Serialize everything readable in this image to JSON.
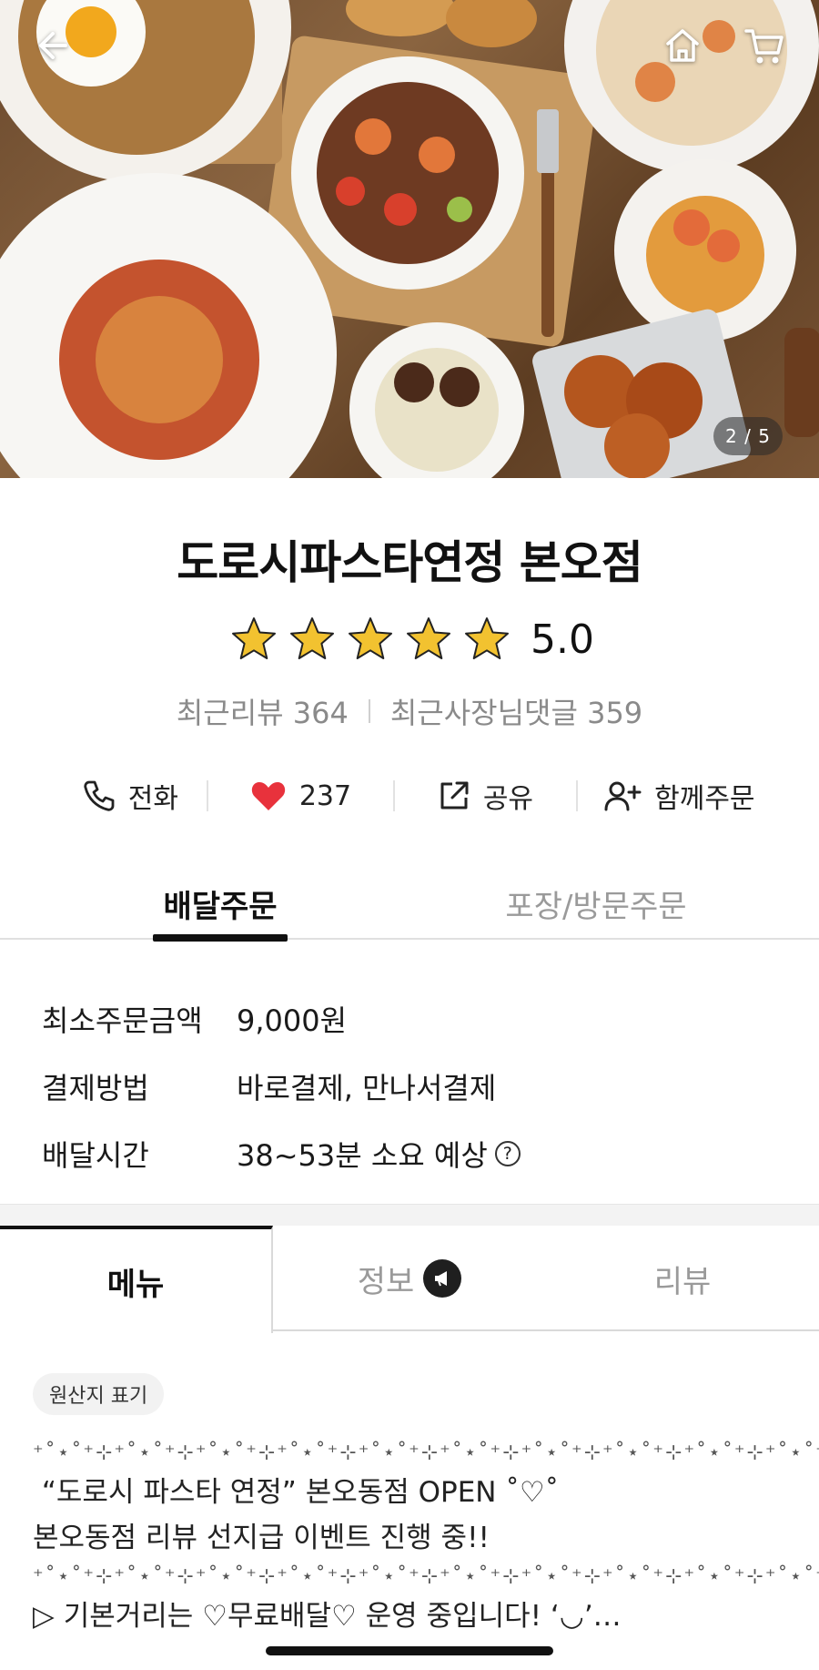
{
  "hero": {
    "image_counter": "2 / 5",
    "icons": [
      "arrow-left-icon",
      "home-icon",
      "cart-icon"
    ]
  },
  "store": {
    "name": "도로시파스타연정 본오점",
    "rating": "5.0",
    "stars_filled": 5,
    "stars_total": 5,
    "recent_reviews": "최근리뷰 364",
    "recent_owner_replies": "최근사장님댓글 359"
  },
  "actions": {
    "call": "전화",
    "likes": "237",
    "share": "공유",
    "group_order": "함께주문"
  },
  "order_tabs": {
    "delivery": "배달주문",
    "pickup": "포장/방문주문",
    "active": "delivery"
  },
  "info": {
    "min_order_label": "최소주문금액",
    "min_order_value": "9,000원",
    "payment_label": "결제방법",
    "payment_value": "바로결제, 만나서결제",
    "delivery_time_label": "배달시간",
    "delivery_time_value": "38~53분 소요 예상"
  },
  "menu_tabs": {
    "menu": "메뉴",
    "info": "정보",
    "review": "리뷰",
    "active": "menu"
  },
  "notice": {
    "origin_label": "원산지 표기",
    "deco_line": "⁺˚⋆˚⁺⊹⁺˚⋆˚⁺⊹⁺˚⋆˚⁺⊹⁺˚⋆˚⁺⊹⁺˚⋆˚⁺⊹⁺˚⋆˚⁺⊹⁺˚⋆˚⁺⊹⁺˚⋆˚⁺⊹⁺˚⋆˚⁺⊹⁺˚⋆˚⁺⊹",
    "line1": " “도로시 파스타 연정” 본오동점 OPEN ˚♡˚",
    "line2": "본오동점 리뷰 선지급 이벤트 진행 중!!",
    "line3": "▷ 기본거리는 ♡무료배달♡ 운영 중입니다! ‘◡’…"
  },
  "colors": {
    "star": "#F2C230",
    "heart": "#E8323C",
    "text_primary": "#111111",
    "text_muted": "#8A8A8A"
  }
}
